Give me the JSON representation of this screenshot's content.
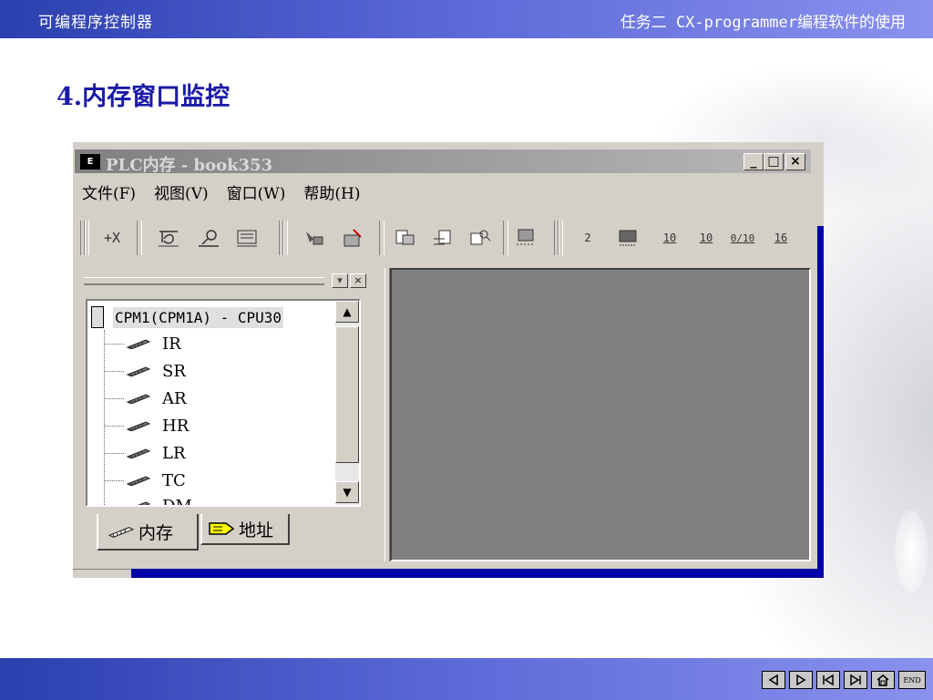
{
  "slide": {
    "header_left": "可编程序控制器",
    "header_right": "任务二 CX-programmer编程软件的使用",
    "title": "4.内存窗口监控",
    "nav_end_label": "END"
  },
  "window": {
    "title": "PLC内存 - book353",
    "icon_label": "E",
    "minimize": "_",
    "maximize": "□",
    "close": "×",
    "menu": [
      "文件(F)",
      "视图(V)",
      "窗口(W)",
      "帮助(H)"
    ],
    "toolbar_labels": [
      "+X",
      "2",
      "10",
      "10",
      "0/10",
      "16"
    ]
  },
  "tree": {
    "root": "CPM1(CPM1A) - CPU30",
    "items": [
      "IR",
      "SR",
      "AR",
      "HR",
      "LR",
      "TC",
      "DM"
    ]
  },
  "tabs": {
    "memory": "内存",
    "address": "地址"
  },
  "colors": {
    "slide_band": "#2b3fae",
    "title_blue": "#1a1aa8",
    "workspace_gray": "#808080",
    "window_face": "#d4d0c8"
  }
}
